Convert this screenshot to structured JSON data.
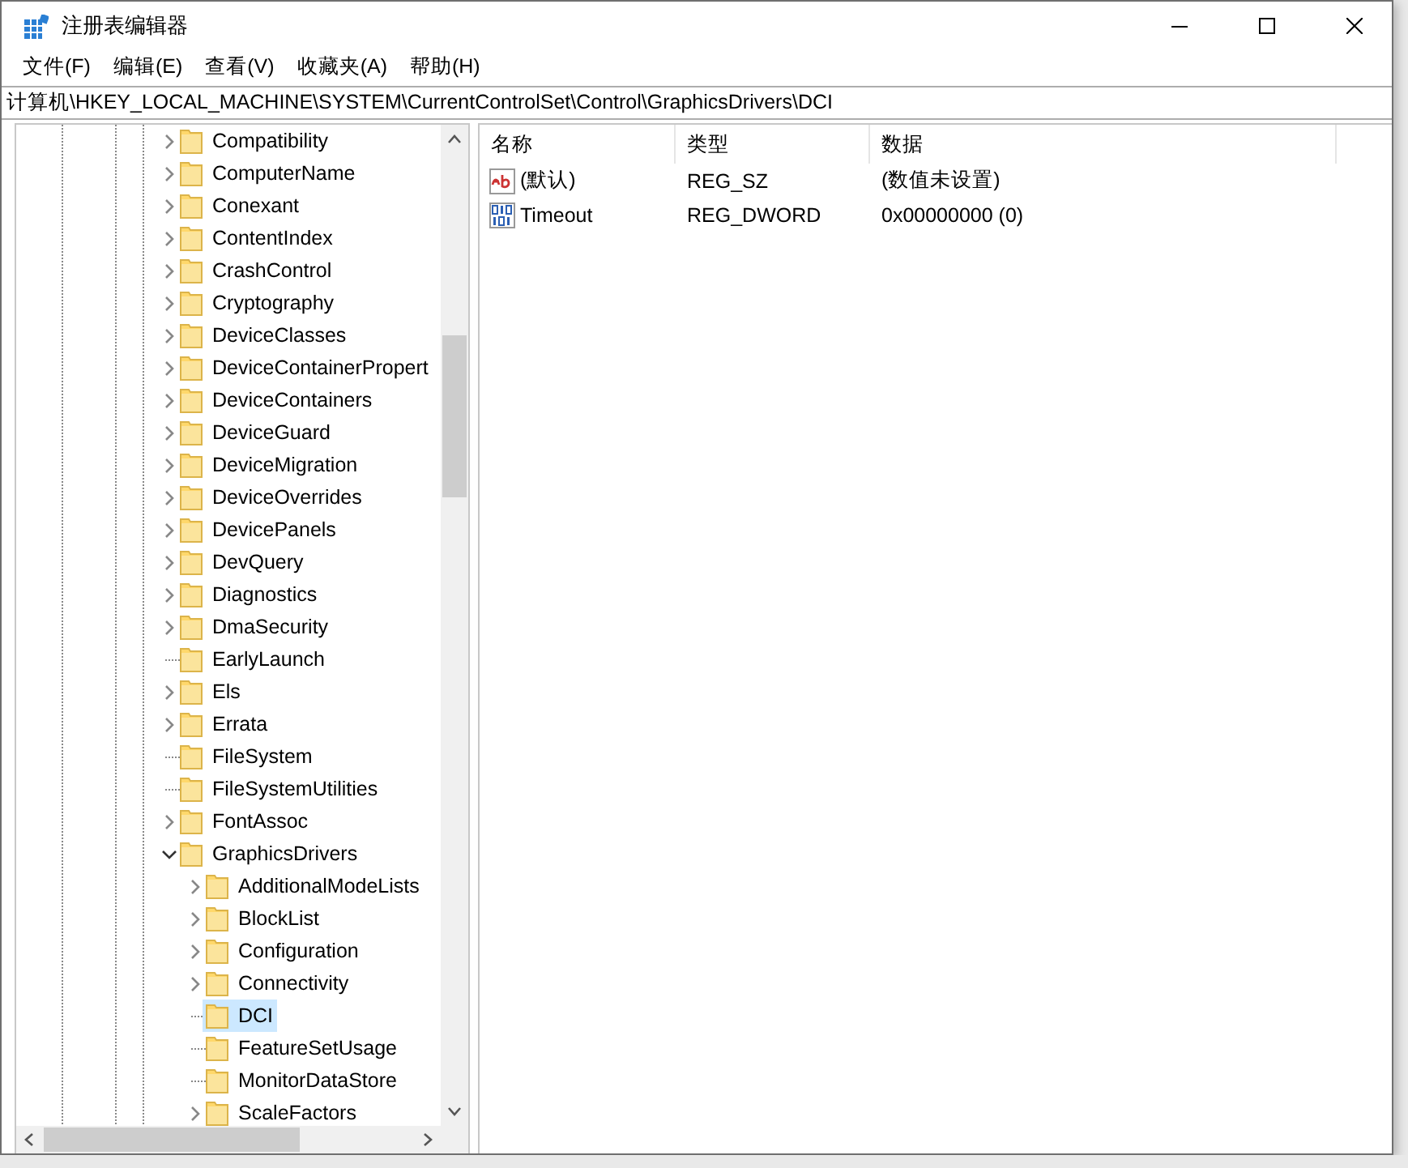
{
  "window": {
    "title": "注册表编辑器"
  },
  "menu": [
    "文件(F)",
    "编辑(E)",
    "查看(V)",
    "收藏夹(A)",
    "帮助(H)"
  ],
  "address": {
    "value": "计算机\\HKEY_LOCAL_MACHINE\\SYSTEM\\CurrentControlSet\\Control\\GraphicsDrivers\\DCI"
  },
  "tree": [
    {
      "label": "Compatibility",
      "has_children": true,
      "expanded": false,
      "selected": false
    },
    {
      "label": "ComputerName",
      "has_children": true,
      "expanded": false,
      "selected": false
    },
    {
      "label": "Conexant",
      "has_children": true,
      "expanded": false,
      "selected": false
    },
    {
      "label": "ContentIndex",
      "has_children": true,
      "expanded": false,
      "selected": false
    },
    {
      "label": "CrashControl",
      "has_children": true,
      "expanded": false,
      "selected": false
    },
    {
      "label": "Cryptography",
      "has_children": true,
      "expanded": false,
      "selected": false
    },
    {
      "label": "DeviceClasses",
      "has_children": true,
      "expanded": false,
      "selected": false
    },
    {
      "label": "DeviceContainerPropert",
      "has_children": true,
      "expanded": false,
      "selected": false
    },
    {
      "label": "DeviceContainers",
      "has_children": true,
      "expanded": false,
      "selected": false
    },
    {
      "label": "DeviceGuard",
      "has_children": true,
      "expanded": false,
      "selected": false
    },
    {
      "label": "DeviceMigration",
      "has_children": true,
      "expanded": false,
      "selected": false
    },
    {
      "label": "DeviceOverrides",
      "has_children": true,
      "expanded": false,
      "selected": false
    },
    {
      "label": "DevicePanels",
      "has_children": true,
      "expanded": false,
      "selected": false
    },
    {
      "label": "DevQuery",
      "has_children": true,
      "expanded": false,
      "selected": false
    },
    {
      "label": "Diagnostics",
      "has_children": true,
      "expanded": false,
      "selected": false
    },
    {
      "label": "DmaSecurity",
      "has_children": true,
      "expanded": false,
      "selected": false
    },
    {
      "label": "EarlyLaunch",
      "has_children": false,
      "selected": false
    },
    {
      "label": "Els",
      "has_children": true,
      "expanded": false,
      "selected": false
    },
    {
      "label": "Errata",
      "has_children": true,
      "expanded": false,
      "selected": false
    },
    {
      "label": "FileSystem",
      "has_children": false,
      "selected": false
    },
    {
      "label": "FileSystemUtilities",
      "has_children": false,
      "selected": false
    },
    {
      "label": "FontAssoc",
      "has_children": true,
      "expanded": false,
      "selected": false
    },
    {
      "label": "GraphicsDrivers",
      "has_children": true,
      "expanded": true,
      "selected": false,
      "children": [
        {
          "label": "AdditionalModeLists",
          "has_children": true,
          "expanded": false,
          "selected": false
        },
        {
          "label": "BlockList",
          "has_children": true,
          "expanded": false,
          "selected": false
        },
        {
          "label": "Configuration",
          "has_children": true,
          "expanded": false,
          "selected": false
        },
        {
          "label": "Connectivity",
          "has_children": true,
          "expanded": false,
          "selected": false
        },
        {
          "label": "DCI",
          "has_children": false,
          "selected": true
        },
        {
          "label": "FeatureSetUsage",
          "has_children": false,
          "selected": false
        },
        {
          "label": "MonitorDataStore",
          "has_children": false,
          "selected": false
        },
        {
          "label": "ScaleFactors",
          "has_children": true,
          "expanded": false,
          "selected": false
        }
      ]
    }
  ],
  "values": {
    "columns": [
      "名称",
      "类型",
      "数据"
    ],
    "rows": [
      {
        "name": "(默认)",
        "type": "REG_SZ",
        "data": "(数值未设置)",
        "kind": "string"
      },
      {
        "name": "Timeout",
        "type": "REG_DWORD",
        "data": "0x00000000 (0)",
        "kind": "binary"
      }
    ]
  }
}
